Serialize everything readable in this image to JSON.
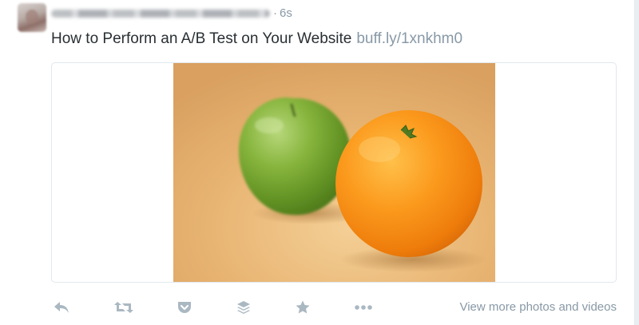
{
  "tweet": {
    "author_name": "",
    "separator": "·",
    "timestamp": "6s",
    "text": "How to Perform an A/B Test on Your Website",
    "link_text": "buff.ly/1xnkhm0"
  },
  "media": {
    "subject": "green apple and orange on wooden table"
  },
  "actions": {
    "icons": [
      "reply-icon",
      "retweet-icon",
      "pocket-icon",
      "buffer-icon",
      "favorite-icon",
      "more-icon"
    ],
    "view_more_label": "View more photos and videos"
  },
  "colors": {
    "text": "#292f33",
    "muted": "#8899a6",
    "icon": "#aab8c2",
    "border": "#e1e8ed"
  }
}
